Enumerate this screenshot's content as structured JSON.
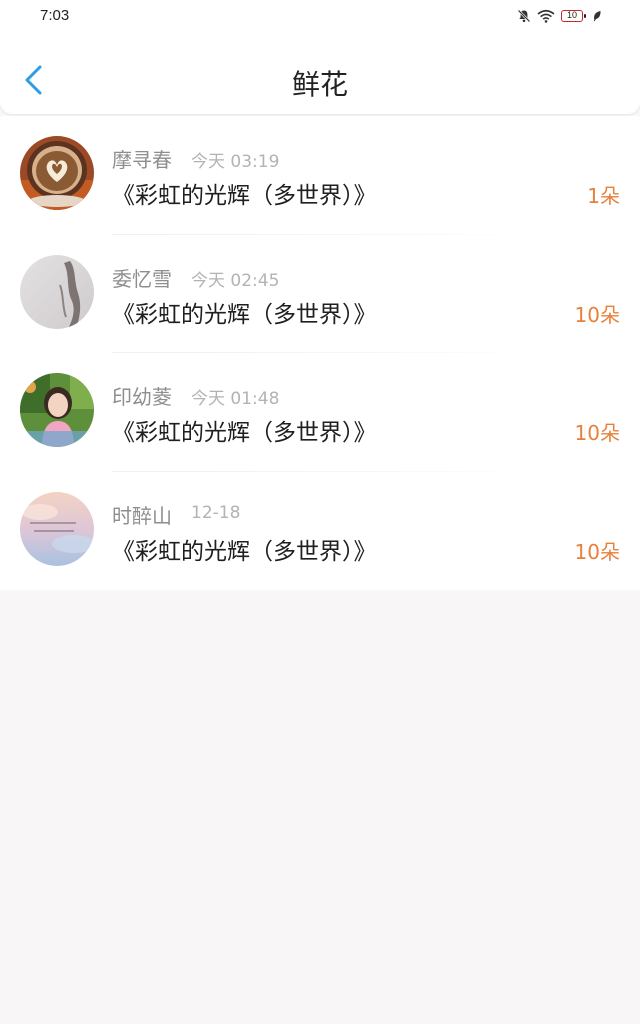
{
  "status_bar": {
    "time": "7:03",
    "battery_level": "10"
  },
  "header": {
    "title": "鲜花",
    "back_icon": "chevron-left-icon",
    "accent_color": "#2f9be4"
  },
  "list": {
    "items": [
      {
        "name": "摩寻春",
        "time": "今天 03:19",
        "title": "《彩虹的光辉（多世界）》",
        "amount": "1朵",
        "avatar": "coffee-latte-art"
      },
      {
        "name": "委忆雪",
        "time": "今天 02:45",
        "title": "《彩虹的光辉（多世界）》",
        "amount": "10朵",
        "avatar": "pale-photo"
      },
      {
        "name": "印幼菱",
        "time": "今天 01:48",
        "title": "《彩虹的光辉（多世界）》",
        "amount": "10朵",
        "avatar": "girl-portrait"
      },
      {
        "name": "时醉山",
        "time": "12-18",
        "title": "《彩虹的光辉（多世界）》",
        "amount": "10朵",
        "avatar": "sunset-sky"
      }
    ],
    "amount_color": "#e8803b"
  }
}
